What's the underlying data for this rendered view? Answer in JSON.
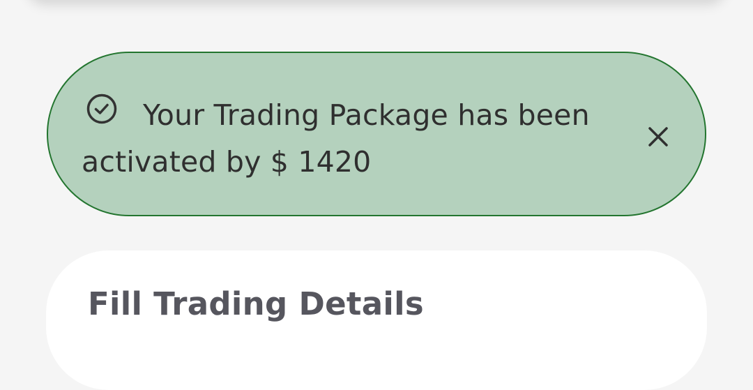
{
  "alert": {
    "icon": "check-circle-icon",
    "message": "Your Trading Package has been activated by $ 1420",
    "close_icon": "close-icon",
    "background": "#b4d1bd",
    "border_color": "#23752f"
  },
  "form_card": {
    "title": "Fill Trading Details"
  }
}
